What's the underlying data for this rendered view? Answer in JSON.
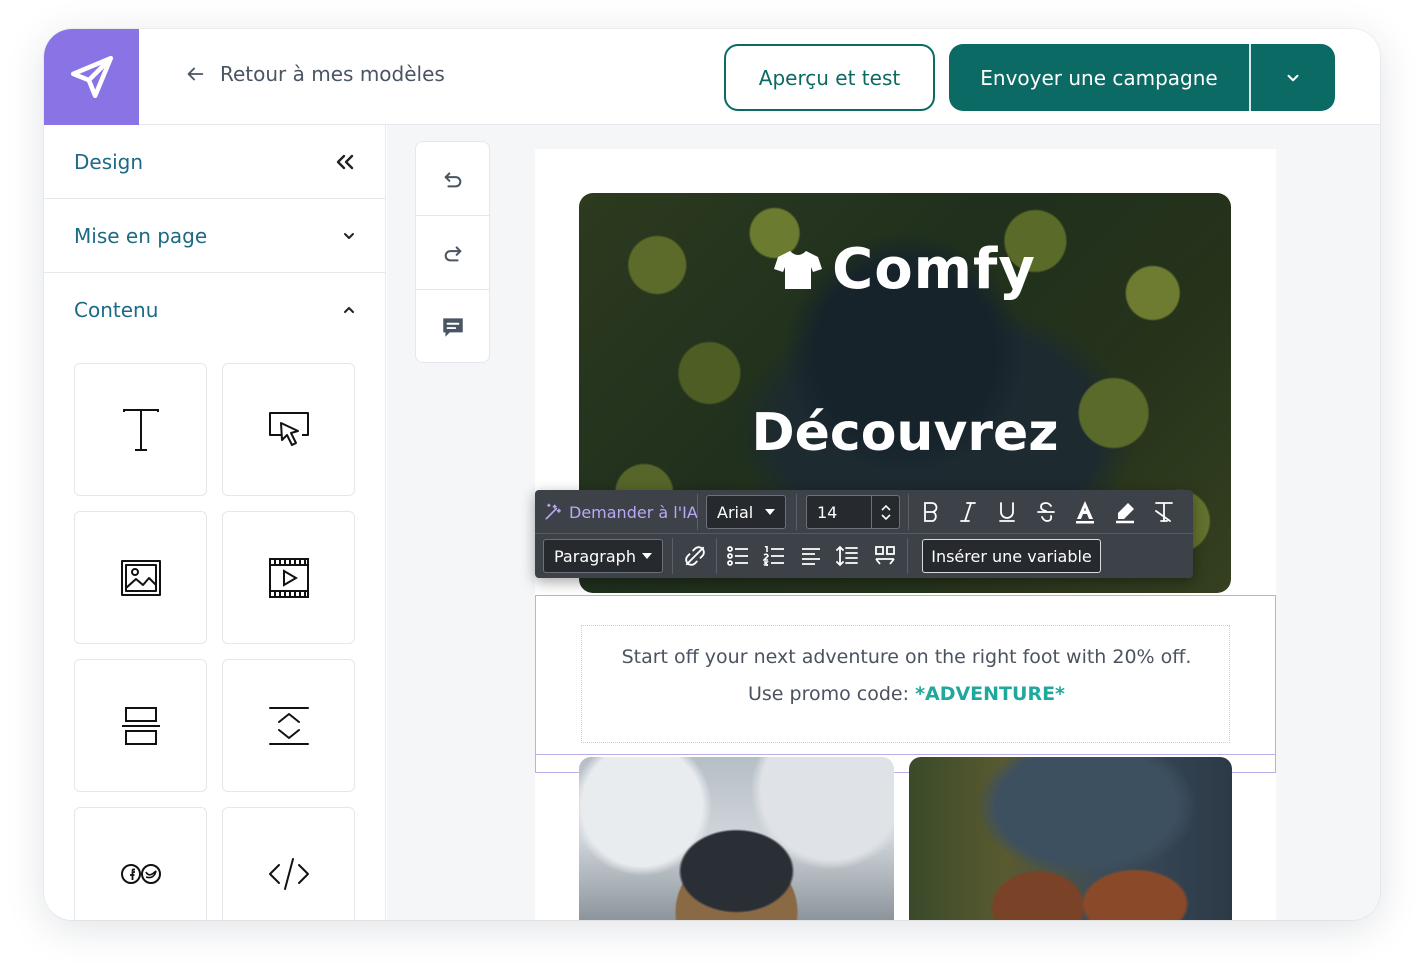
{
  "header": {
    "back_label": "Retour à mes modèles",
    "preview_button": "Aperçu et test",
    "send_button": "Envoyer une campagne"
  },
  "sidebar": {
    "sections": [
      {
        "label": "Design"
      },
      {
        "label": "Mise en page"
      },
      {
        "label": "Contenu"
      }
    ],
    "tiles": [
      "text-icon",
      "button-icon",
      "image-icon",
      "video-icon",
      "divider-icon",
      "spacer-icon",
      "social-icon",
      "html-icon"
    ]
  },
  "email": {
    "brand": "Comfy",
    "headline": "Découvrez",
    "body_line1": "Start off your next adventure on the right foot with 20% off.",
    "body_line2_prefix": "Use promo code: ",
    "promo_code": "*ADVENTURE*"
  },
  "toolbar": {
    "ai_label": "Demander à l'IA",
    "font": "Arial",
    "size": "14",
    "paragraph": "Paragraph",
    "insert_variable": "Insérer une variable"
  },
  "colors": {
    "brand_purple": "#8a73e4",
    "primary_teal": "#0b6a64",
    "promo_teal": "#1fa89b"
  }
}
